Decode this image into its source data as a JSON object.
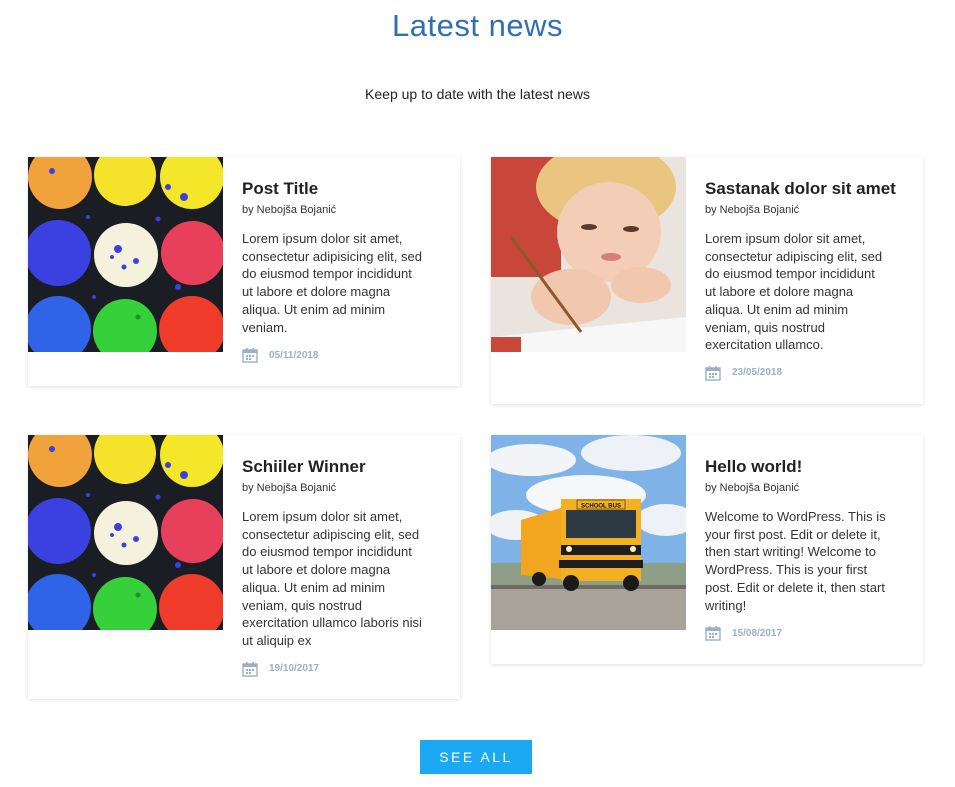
{
  "section": {
    "title": "Latest news",
    "subtitle": "Keep up to date with the latest news"
  },
  "posts": [
    {
      "title": "Post Title",
      "author": "by Nebojša Bojanić",
      "excerpt": "Lorem ipsum dolor sit amet,\nconsectetur adipisicing elit, sed\ndo eiusmod tempor incididunt\nut labore et dolore magna\naliqua. Ut enim ad minim\nveniam.",
      "date": "05/11/2018",
      "image": "watercolor-paints"
    },
    {
      "title": "Sastanak dolor sit amet",
      "author": "by Nebojša Bojanić",
      "excerpt": "Lorem ipsum dolor sit amet,\nconsectetur adipiscing elit, sed\ndo eiusmod tempor incididunt\nut labore et dolore magna\naliqua. Ut enim ad minim\nveniam, quis nostrud\nexercitation ullamco.",
      "date": "23/05/2018",
      "image": "child-drawing"
    },
    {
      "title": "Schiiler Winner",
      "author": "by Nebojša Bojanić",
      "excerpt": "Lorem ipsum dolor sit amet,\nconsectetur adipiscing elit, sed\ndo eiusmod tempor incididunt\nut labore et dolore magna\naliqua. Ut enim ad minim\nveniam, quis nostrud\nexercitation ullamco laboris nisi\nut aliquip ex",
      "date": "19/10/2017",
      "image": "watercolor-paints"
    },
    {
      "title": "Hello world!",
      "author": "by Nebojša Bojanić",
      "excerpt": "Welcome to WordPress. This is\nyour first post. Edit or delete it,\nthen start writing! Welcome to\nWordPress. This is your first\npost. Edit or delete it, then start\nwriting!",
      "date": "15/08/2017",
      "image": "school-bus",
      "bus_sign": "SCHOOL BUS"
    }
  ],
  "see_all_label": "SEE ALL",
  "colors": {
    "heading": "#2f6fb2",
    "button": "#1aa9f2",
    "date": "#9bb0c8"
  },
  "icons": {
    "date": "calendar-icon"
  }
}
